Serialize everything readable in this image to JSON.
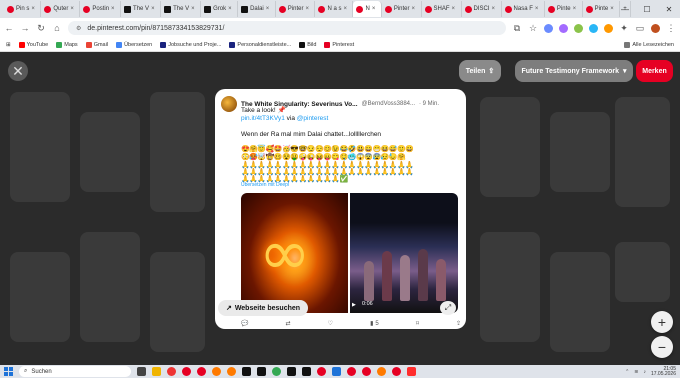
{
  "browser": {
    "tabs": [
      {
        "label": "Pin s",
        "favicon": "pinterest"
      },
      {
        "label": "Quter",
        "favicon": "pinterest"
      },
      {
        "label": "Postin",
        "favicon": "pinterest"
      },
      {
        "label": "The V",
        "favicon": "x"
      },
      {
        "label": "The V",
        "favicon": "x"
      },
      {
        "label": "Grok",
        "favicon": "x"
      },
      {
        "label": "Dalai",
        "favicon": "x"
      },
      {
        "label": "Pinter",
        "favicon": "pinterest"
      },
      {
        "label": "N a s",
        "favicon": "pinterest"
      },
      {
        "label": "N",
        "favicon": "pinterest",
        "active": true
      },
      {
        "label": "Pinter",
        "favicon": "pinterest"
      },
      {
        "label": "SHAF",
        "favicon": "pinterest"
      },
      {
        "label": "DISCI",
        "favicon": "pinterest"
      },
      {
        "label": "Nasa F",
        "favicon": "pinterest"
      },
      {
        "label": "Pinte",
        "favicon": "pinterest"
      },
      {
        "label": "Pinte",
        "favicon": "pinterest"
      }
    ],
    "url": "de.pinterest.com/pin/871587334153829731/",
    "bookmarks": [
      {
        "label": "YouTube",
        "color": "#ff0000"
      },
      {
        "label": "Maps",
        "color": "#34a853"
      },
      {
        "label": "Gmail",
        "color": "#ea4335"
      },
      {
        "label": "Übersetzen",
        "color": "#4285f4"
      },
      {
        "label": "Jobsuche und Proje...",
        "color": "#1a237e"
      },
      {
        "label": "Personaldienstleiste...",
        "color": "#1a237e"
      },
      {
        "label": "Bild",
        "color": "#111111"
      },
      {
        "label": "Pinterest",
        "color": "#e60023"
      }
    ],
    "all_bookmarks": "Alle Lesezeichen"
  },
  "pin_toolbar": {
    "share_label": "Teilen",
    "board_label": "Future Testimony Framework",
    "save_label": "Merken"
  },
  "tweet": {
    "name": "The White Singularity: Severinus Vo...",
    "handle": "@BerndVoss3884...",
    "time": "· 9 Min.",
    "line1": "Take a look! 📌",
    "link": "pin.it/4tT3KVy1",
    "via": "via",
    "via_handle": "@pinterest",
    "text": "Wenn der Ra mal mim Dalai chattet...lolllllerchen",
    "emoji_rows": [
      "😍🤗😇🥰🤩🥳😎🤓😏😌😊😉😂🤣😃😄😁😆😅🙂😀",
      "😳🥵🤯🤠🥴😵🤑🤪😜😝😛😋🤤🥶😱😨😰😥😓🤗",
      "🙏🙏🙏🙏🙏🙏🙏🙏🙏🙏🙏🙏🙏🙏🙏🙏🙏🙏🙏🙏🙏",
      "🙏🙏🙏🙏🙏🙏🙏🙏🙏🙏🙏🙏🙏🙏🙏🙏🙏🙏🙏🙏🙏",
      "🙏🙏🙏🙏🙏🙏🙏🙏🙏🙏🙏🙏✅"
    ],
    "translate": "Übersetzen mit Deepl",
    "video_time": "0:06",
    "visit_label": "Webseite besuchen",
    "views": "5"
  },
  "taskbar": {
    "search": "Suchen",
    "time": "21:05",
    "date": "17.05.2026"
  }
}
